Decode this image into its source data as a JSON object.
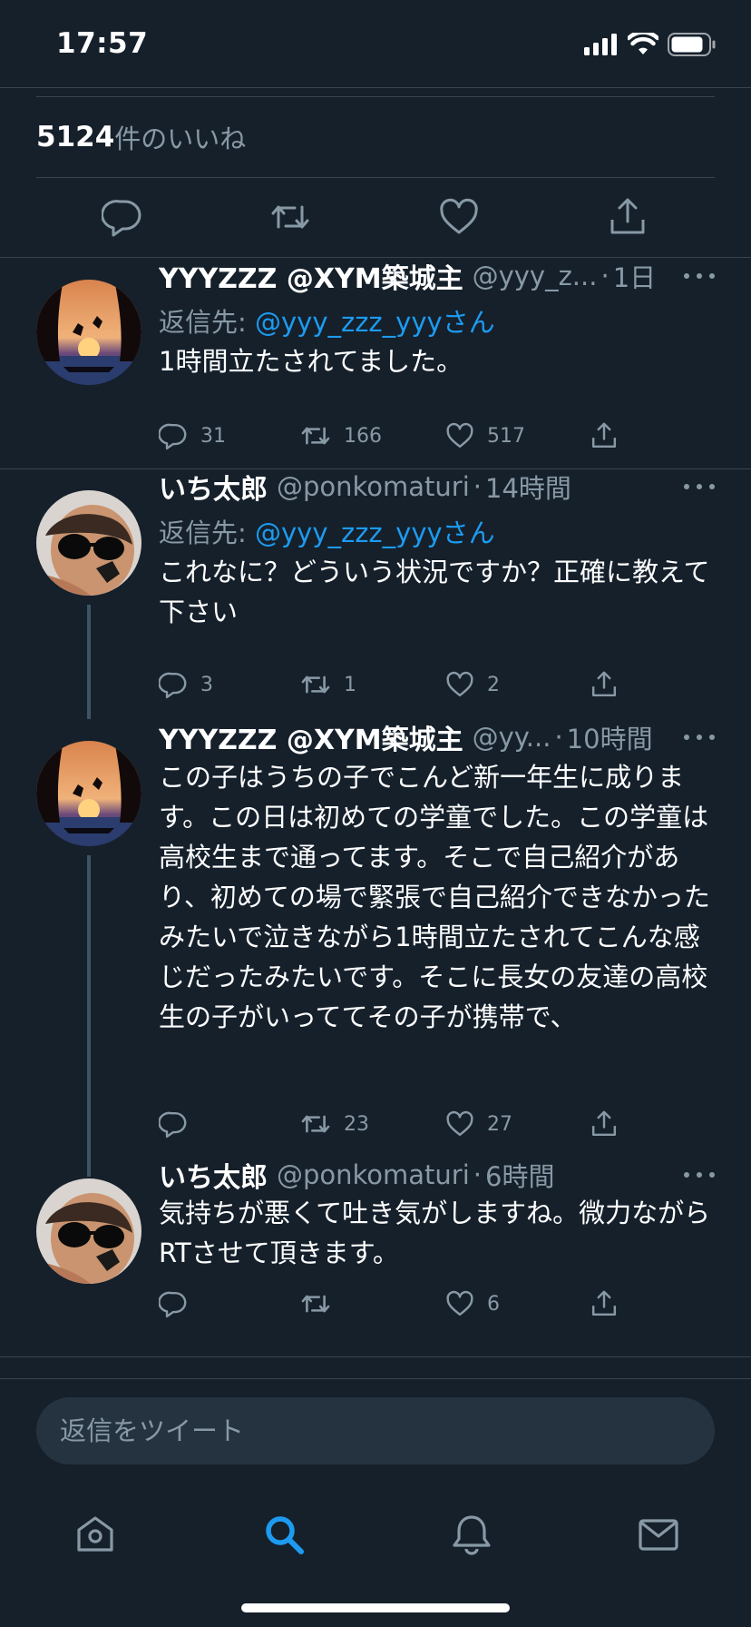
{
  "status_bar": {
    "time": "17:57"
  },
  "likes": {
    "count": "5124",
    "label": "件のいいね"
  },
  "reply_prefix": "返信先: ",
  "tweets": [
    {
      "name": "YYYZZZ @XYM築城主",
      "handle": "@yyy_z...",
      "time": "1日",
      "reply_to": "@yyy_zzz_yyyさん",
      "text": "1時間立たされてました。",
      "replies": "31",
      "retweets": "166",
      "likes": "517"
    },
    {
      "name": "いち太郎",
      "handle": "@ponkomaturi",
      "time": "14時間",
      "reply_to": "@yyy_zzz_yyyさん",
      "text": "これなに？どういう状況ですか？正確に教えて下さい",
      "replies": "3",
      "retweets": "1",
      "likes": "2"
    },
    {
      "name": "YYYZZZ @XYM築城主",
      "handle": "@yy...",
      "time": "10時間",
      "text": "この子はうちの子でこんど新一年生に成ります。この日は初めての学童でした。この学童は高校生まで通ってます。そこで自己紹介があり、初めての場で緊張で自己紹介できなかったみたいで泣きながら1時間立たされてこんな感じだったみたいです。そこに長女の友達の高校生の子がいっててその子が携帯で、",
      "replies": "",
      "retweets": "23",
      "likes": "27"
    },
    {
      "name": "いち太郎",
      "handle": "@ponkomaturi",
      "time": "6時間",
      "text": "気持ちが悪くて吐き気がしますね。微力ながらRTさせて頂きます。",
      "replies": "",
      "retweets": "",
      "likes": "6"
    }
  ],
  "composer": {
    "placeholder": "返信をツイート"
  },
  "tabs": [
    "home-icon",
    "search-icon",
    "notifications-icon",
    "messages-icon"
  ],
  "colors": {
    "background": "#15202b",
    "accent": "#1d9bf0",
    "muted": "#8899a6",
    "divider": "#38444d"
  }
}
